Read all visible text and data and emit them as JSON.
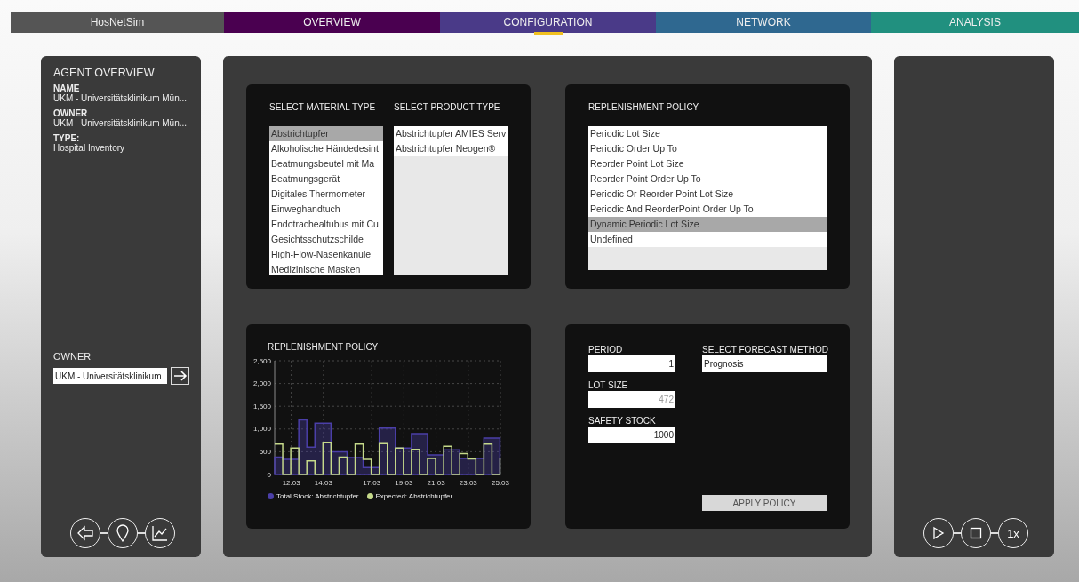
{
  "app_title": "HosNetSim",
  "tabs": [
    {
      "label": "OVERVIEW",
      "selected": false,
      "color": "#4a0050"
    },
    {
      "label": "CONFIGURATION",
      "selected": true,
      "color": "#4a3a88"
    },
    {
      "label": "NETWORK",
      "selected": false,
      "color": "#2f6890"
    },
    {
      "label": "ANALYSIS",
      "selected": false,
      "color": "#21907f"
    }
  ],
  "agent_overview": {
    "title": "AGENT OVERVIEW",
    "fields": [
      {
        "label": "NAME",
        "value": "UKM - Universitätsklinikum Mün..."
      },
      {
        "label": "OWNER",
        "value": "UKM - Universitätsklinikum Mün..."
      },
      {
        "label": "TYPE:",
        "value": "Hospital Inventory"
      }
    ]
  },
  "owner_select": {
    "label": "OWNER",
    "value": "UKM - Universitätsklinikum"
  },
  "left_controls": [
    {
      "kind": "back"
    },
    {
      "kind": "pin"
    },
    {
      "kind": "chart"
    }
  ],
  "material_list": {
    "title": "SELECT MATERIAL TYPE",
    "items": [
      {
        "label": "Abstrichtupfer",
        "selected": true
      },
      {
        "label": "Alkoholische Händedesint",
        "selected": false
      },
      {
        "label": "Beatmungsbeutel mit Ma",
        "selected": false
      },
      {
        "label": "Beatmungsgerät",
        "selected": false
      },
      {
        "label": "Digitales Thermometer",
        "selected": false
      },
      {
        "label": "Einweghandtuch",
        "selected": false
      },
      {
        "label": "Endotrachealtubus mit Cu",
        "selected": false
      },
      {
        "label": "Gesichtsschutzschilde",
        "selected": false
      },
      {
        "label": "High-Flow-Nasenkanüle",
        "selected": false
      },
      {
        "label": "Medizinische Masken",
        "selected": false
      }
    ]
  },
  "product_list": {
    "title": "SELECT PRODUCT TYPE",
    "items": [
      {
        "label": "Abstrichtupfer AMIES Serv",
        "selected": false
      },
      {
        "label": "Abstrichtupfer Neogen®",
        "selected": false
      }
    ]
  },
  "policy_list": {
    "title": "REPLENISHMENT POLICY",
    "items": [
      {
        "label": "Periodic Lot Size",
        "selected": false
      },
      {
        "label": "Periodic Order Up To",
        "selected": false
      },
      {
        "label": "Reorder Point Lot Size",
        "selected": false
      },
      {
        "label": "Reorder Point Order Up To",
        "selected": false
      },
      {
        "label": "Periodic Or Reorder Point Lot Size",
        "selected": false
      },
      {
        "label": "Periodic And ReorderPoint Order Up To",
        "selected": false
      },
      {
        "label": "Dynamic Periodic Lot Size",
        "selected": true
      },
      {
        "label": "Undefined",
        "selected": false
      }
    ]
  },
  "chart_panel": {
    "title": "REPLENISHMENT POLICY",
    "chart_data": {
      "type": "line",
      "x": [
        11,
        11.5,
        11.5,
        12,
        12,
        12.5,
        12.5,
        13,
        13,
        13.5,
        13.5,
        14,
        14,
        14.5,
        14.5,
        15,
        15,
        15.5,
        15.5,
        16,
        16,
        16.5,
        16.5,
        17,
        17,
        17.5,
        17.5,
        18,
        18,
        18.5,
        18.5,
        19,
        19,
        19.5,
        19.5,
        20,
        20,
        20.5,
        20.5,
        21,
        21,
        21.5,
        21.5,
        22,
        22,
        22.5,
        22.5,
        23,
        23,
        23.5,
        23.5,
        24,
        24,
        24.5,
        24.5,
        25,
        25
      ],
      "series": [
        {
          "name": "Total Stock: Abstrichtupfer",
          "type": "area",
          "color": "#4b3fa8",
          "values": [
            380,
            380,
            330,
            330,
            330,
            330,
            1200,
            1200,
            600,
            600,
            1130,
            1130,
            1130,
            1130,
            500,
            500,
            500,
            500,
            370,
            370,
            370,
            370,
            150,
            150,
            150,
            150,
            1020,
            1020,
            1020,
            1020,
            580,
            580,
            580,
            580,
            900,
            900,
            900,
            900,
            430,
            430,
            430,
            430,
            540,
            540,
            540,
            540,
            350,
            350,
            350,
            350,
            350,
            350,
            800,
            800,
            800,
            800,
            800
          ]
        },
        {
          "name": "Expected: Abstrichtupfer",
          "type": "line",
          "color": "#c5d98a",
          "values": [
            670,
            670,
            0,
            0,
            580,
            580,
            0,
            0,
            300,
            300,
            0,
            0,
            700,
            700,
            0,
            0,
            380,
            380,
            0,
            0,
            670,
            670,
            330,
            330,
            0,
            0,
            680,
            680,
            0,
            0,
            580,
            580,
            0,
            0,
            550,
            550,
            0,
            0,
            350,
            350,
            0,
            0,
            620,
            620,
            0,
            0,
            460,
            460,
            340,
            340,
            0,
            0,
            670,
            670,
            0,
            0,
            350
          ]
        }
      ],
      "xlim": [
        11,
        25.03
      ],
      "ylim": [
        0,
        2500
      ],
      "grid": true,
      "legend": "bottom",
      "xticks": [
        12.03,
        14.03,
        17.03,
        19.03,
        21.03,
        23.03,
        25.03
      ],
      "yticks": [
        {
          "value": 0,
          "label": "0"
        },
        {
          "value": 500,
          "label": "500"
        },
        {
          "value": 1000,
          "label": "1,000"
        },
        {
          "value": 1500,
          "label": "1,500"
        },
        {
          "value": 2000,
          "label": "2,000"
        },
        {
          "value": 2500,
          "label": "2,500"
        }
      ]
    }
  },
  "settings": {
    "fields": [
      {
        "label": "PERIOD",
        "value": "1"
      },
      {
        "label": "LOT SIZE",
        "placeholder": "472"
      },
      {
        "label": "SAFETY STOCK",
        "value": "1000"
      }
    ],
    "forecast": {
      "label": "SELECT FORECAST METHOD",
      "value": "Prognosis"
    },
    "apply_button": "APPLY POLICY"
  },
  "right_controls": [
    {
      "kind": "play"
    },
    {
      "kind": "stop"
    },
    {
      "kind": "speed",
      "label": "1x"
    }
  ]
}
